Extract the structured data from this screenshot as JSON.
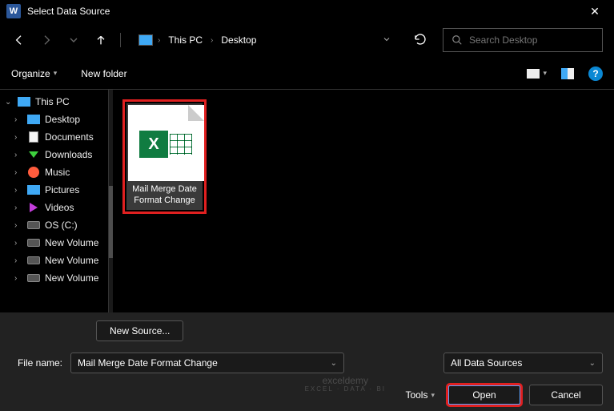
{
  "titlebar": {
    "title": "Select Data Source"
  },
  "address": {
    "segments": [
      "This PC",
      "Desktop"
    ]
  },
  "search": {
    "placeholder": "Search Desktop"
  },
  "toolbar": {
    "organize": "Organize",
    "new_folder": "New folder"
  },
  "sidebar": {
    "items": [
      {
        "name": "pc",
        "label": "This PC",
        "expanded": true,
        "level": 0,
        "icon": "pc"
      },
      {
        "name": "desktop",
        "label": "Desktop",
        "expanded": false,
        "level": 1,
        "icon": "desktop"
      },
      {
        "name": "documents",
        "label": "Documents",
        "expanded": false,
        "level": 1,
        "icon": "doc"
      },
      {
        "name": "downloads",
        "label": "Downloads",
        "expanded": false,
        "level": 1,
        "icon": "dl"
      },
      {
        "name": "music",
        "label": "Music",
        "expanded": false,
        "level": 1,
        "icon": "music"
      },
      {
        "name": "pictures",
        "label": "Pictures",
        "expanded": false,
        "level": 1,
        "icon": "pic"
      },
      {
        "name": "videos",
        "label": "Videos",
        "expanded": false,
        "level": 1,
        "icon": "vid"
      },
      {
        "name": "osc",
        "label": "OS (C:)",
        "expanded": false,
        "level": 1,
        "icon": "drive"
      },
      {
        "name": "nv1",
        "label": "New Volume",
        "expanded": false,
        "level": 1,
        "icon": "drive"
      },
      {
        "name": "nv2",
        "label": "New Volume",
        "expanded": false,
        "level": 1,
        "icon": "drive"
      },
      {
        "name": "nv3",
        "label": "New Volume",
        "expanded": false,
        "level": 1,
        "icon": "drive"
      }
    ]
  },
  "files": [
    {
      "name": "mail-merge-date-format-change",
      "label": "Mail Merge Date Format Change",
      "selected": true,
      "highlighted": true
    }
  ],
  "bottom": {
    "new_source": "New Source...",
    "file_name_label": "File name:",
    "file_name_value": "Mail Merge Date Format Change",
    "filter_value": "All Data Sources",
    "tools": "Tools",
    "open": "Open",
    "cancel": "Cancel"
  },
  "watermark": {
    "main": "exceldemy",
    "sub": "EXCEL · DATA · BI"
  }
}
